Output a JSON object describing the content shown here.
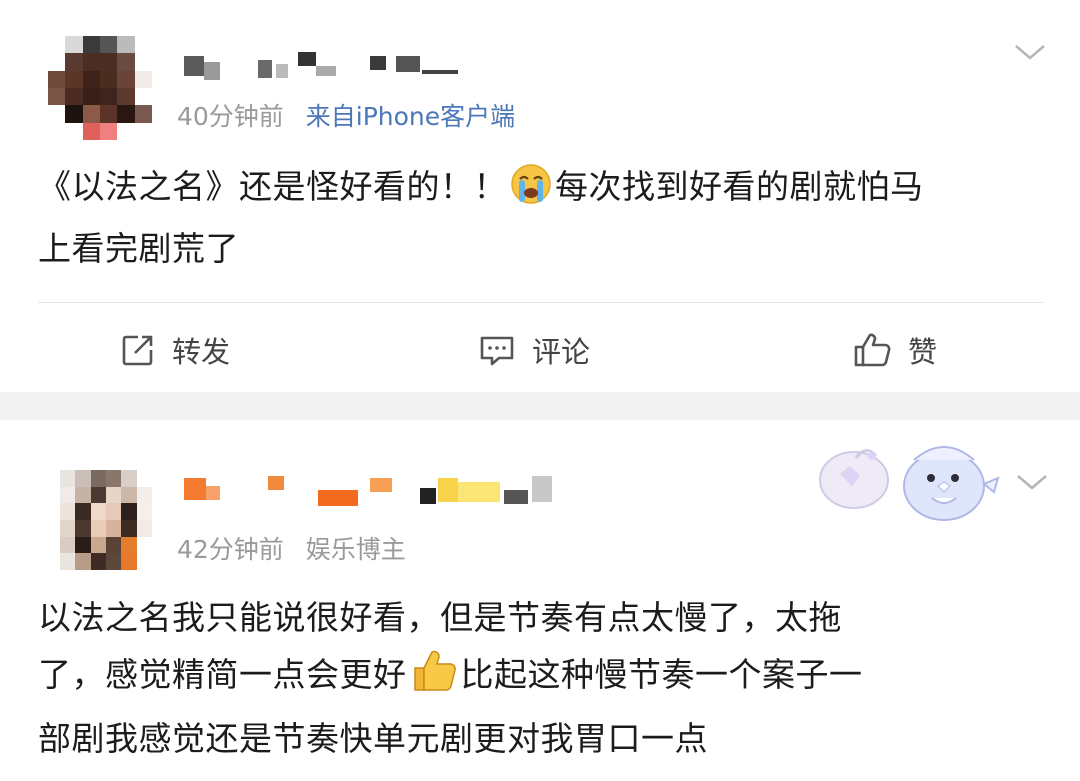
{
  "post1": {
    "time": "40分钟前",
    "source": "来自iPhone客户端",
    "text_line1": "《以法之名》还是怪好看的！！",
    "text_line1b": "每次找到好看的剧就怕马",
    "text_line2": "上看完剧荒了",
    "emoji": "crying-face",
    "actions": {
      "repost": "转发",
      "comment": "评论",
      "like": "赞"
    }
  },
  "post2": {
    "time": "42分钟前",
    "tag": "娱乐博主",
    "text_line1": "以法之名我只能说很好看，但是节奏有点太慢了，太拖",
    "text_line2a": "了，感觉精简一点会更好",
    "text_line2b": "比起这种慢节奏一个案子一",
    "text_line3": "部剧我感觉还是节奏快单元剧更对我胃口一点",
    "emoji": "thumbs-up",
    "sticker": "bird-mascot"
  },
  "colors": {
    "link_blue": "#4c78b8",
    "meta_gray": "#9a9a9a",
    "separator": "#f2f2f2"
  }
}
